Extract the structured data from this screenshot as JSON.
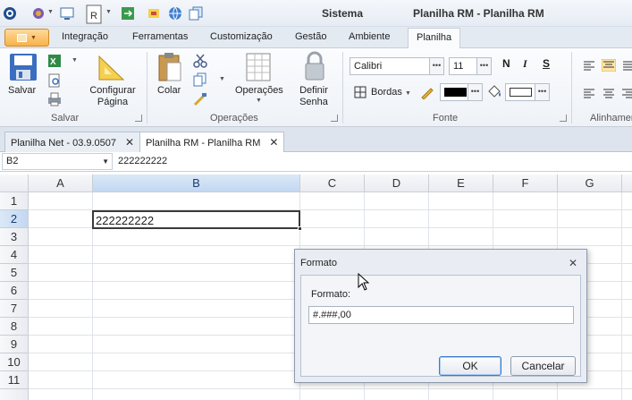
{
  "titlebar": {
    "app_title": "Sistema",
    "window_title": "Planilha RM - Planilha RM",
    "quick_access_icons": [
      "app-logo-icon",
      "lock-icon",
      "chevron-down-icon",
      "monitor-icon",
      "document-r-icon",
      "export-icon",
      "paint-icon",
      "globe-icon",
      "copy-icon"
    ]
  },
  "menu_tabs": [
    {
      "label": "Integração"
    },
    {
      "label": "Ferramentas"
    },
    {
      "label": "Customização"
    },
    {
      "label": "Gestão"
    },
    {
      "label": "Ambiente"
    },
    {
      "label": "Planilha",
      "active": true
    }
  ],
  "ribbon": {
    "groups": {
      "salvar": {
        "label": "Salvar",
        "buttons": {
          "save": "Salvar",
          "config_page": "Configurar Página"
        }
      },
      "operacoes": {
        "label": "Operações",
        "buttons": {
          "paste": "Colar",
          "operations": "Operações",
          "define_password": "Definir Senha"
        }
      },
      "fonte": {
        "label": "Fonte",
        "font_name": "Calibri",
        "font_size": "11",
        "bold": "N",
        "italic": "I",
        "strike": "S",
        "borders": "Bordas"
      },
      "alinhamento": {
        "label": "Alinhamen"
      }
    }
  },
  "document_tabs": [
    {
      "label": "Planilha Net - 03.9.0507"
    },
    {
      "label": "Planilha RM - Planilha RM",
      "active": true
    }
  ],
  "formula_bar": {
    "cell_ref": "B2",
    "value": "222222222"
  },
  "grid": {
    "columns": [
      "A",
      "B",
      "C",
      "D",
      "E",
      "F",
      "G"
    ],
    "rows": [
      "1",
      "2",
      "3",
      "4",
      "5",
      "6",
      "7",
      "8",
      "9",
      "10",
      "11"
    ],
    "selected_cell": {
      "column": "B",
      "row": "2",
      "value": "222222222"
    }
  },
  "dialog": {
    "title": "Formato",
    "label": "Formato:",
    "input_value": "#.###,00",
    "ok": "OK",
    "cancel": "Cancelar"
  },
  "colors": {
    "accent": "#3d7bc8",
    "file_button": "#f8b24a",
    "selection": "#c2d8f1"
  }
}
